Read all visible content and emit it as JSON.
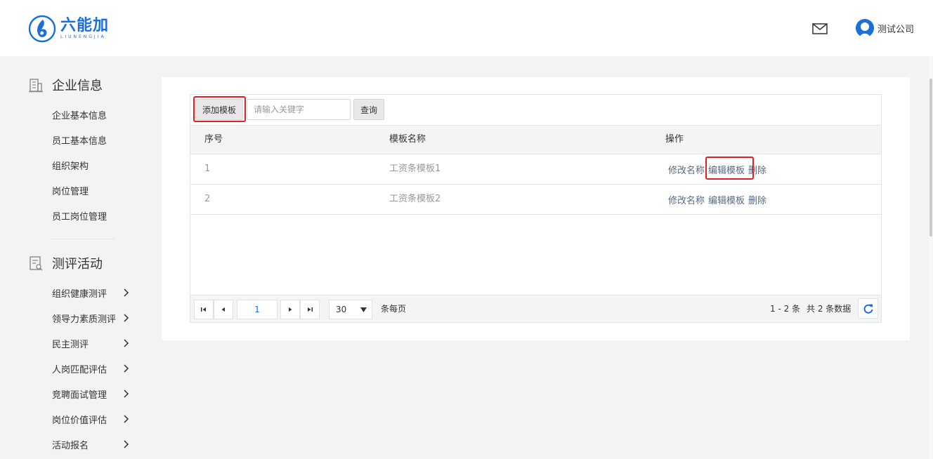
{
  "header": {
    "logo_cn": "六能加",
    "logo_en": "LIUNENGJIA",
    "user_name": "测试公司",
    "icons": {
      "mail": "mail-icon",
      "avatar": "user-avatar-icon"
    },
    "brand_color": "#1a6fd8"
  },
  "sidebar": {
    "sections": [
      {
        "title": "企业信息",
        "icon": "building-icon",
        "items": [
          {
            "label": "企业基本信息",
            "has_arrow": false
          },
          {
            "label": "员工基本信息",
            "has_arrow": false
          },
          {
            "label": "组织架构",
            "has_arrow": false
          },
          {
            "label": "岗位管理",
            "has_arrow": false
          },
          {
            "label": "员工岗位管理",
            "has_arrow": false
          }
        ]
      },
      {
        "title": "测评活动",
        "icon": "assessment-icon",
        "items": [
          {
            "label": "组织健康测评",
            "has_arrow": true
          },
          {
            "label": "领导力素质测评",
            "has_arrow": true
          },
          {
            "label": "民主测评",
            "has_arrow": true
          },
          {
            "label": "人岗匹配评估",
            "has_arrow": true
          },
          {
            "label": "竞聘面试管理",
            "has_arrow": true
          },
          {
            "label": "岗位价值评估",
            "has_arrow": true
          },
          {
            "label": "活动报名",
            "has_arrow": true
          }
        ]
      }
    ]
  },
  "toolbar": {
    "add_label": "添加模板",
    "search_placeholder": "请输入关键字",
    "search_value": "",
    "query_label": "查询"
  },
  "table": {
    "columns": [
      "序号",
      "模板名称",
      "操作"
    ],
    "rows": [
      {
        "index": "1",
        "name": "工资条模板1"
      },
      {
        "index": "2",
        "name": "工资条模板2"
      }
    ],
    "actions": [
      "修改名称",
      "编辑模板",
      "删除"
    ]
  },
  "pager": {
    "current_page": "1",
    "page_size": "30",
    "per_page_label": "条每页",
    "range_text": "1 - 2 条",
    "total_text": "共 2 条数据",
    "icons": [
      "first-page-icon",
      "prev-page-icon",
      "next-page-icon",
      "last-page-icon",
      "dropdown-arrow-icon",
      "refresh-icon"
    ]
  },
  "highlight_color": "#e02020"
}
